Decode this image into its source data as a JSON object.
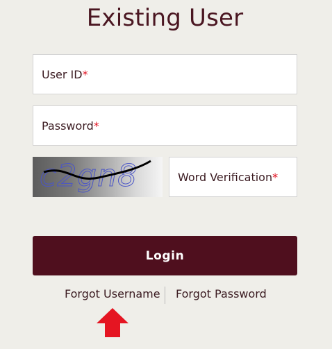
{
  "title": "Existing User",
  "fields": {
    "user_id": {
      "label": "User ID",
      "required_mark": "*"
    },
    "password": {
      "label": "Password",
      "required_mark": "*"
    },
    "word_verification": {
      "label": "Word Verification",
      "required_mark": "*"
    }
  },
  "captcha": {
    "text": "c2gn8"
  },
  "login_label": "Login",
  "links": {
    "forgot_username": "Forgot Username",
    "forgot_password": "Forgot Password"
  },
  "colors": {
    "background": "#efeee9",
    "brand": "#4f0f1e",
    "required": "#e01020",
    "arrow": "#e51522"
  },
  "icons": {
    "pointer": "red-up-arrow-icon"
  }
}
